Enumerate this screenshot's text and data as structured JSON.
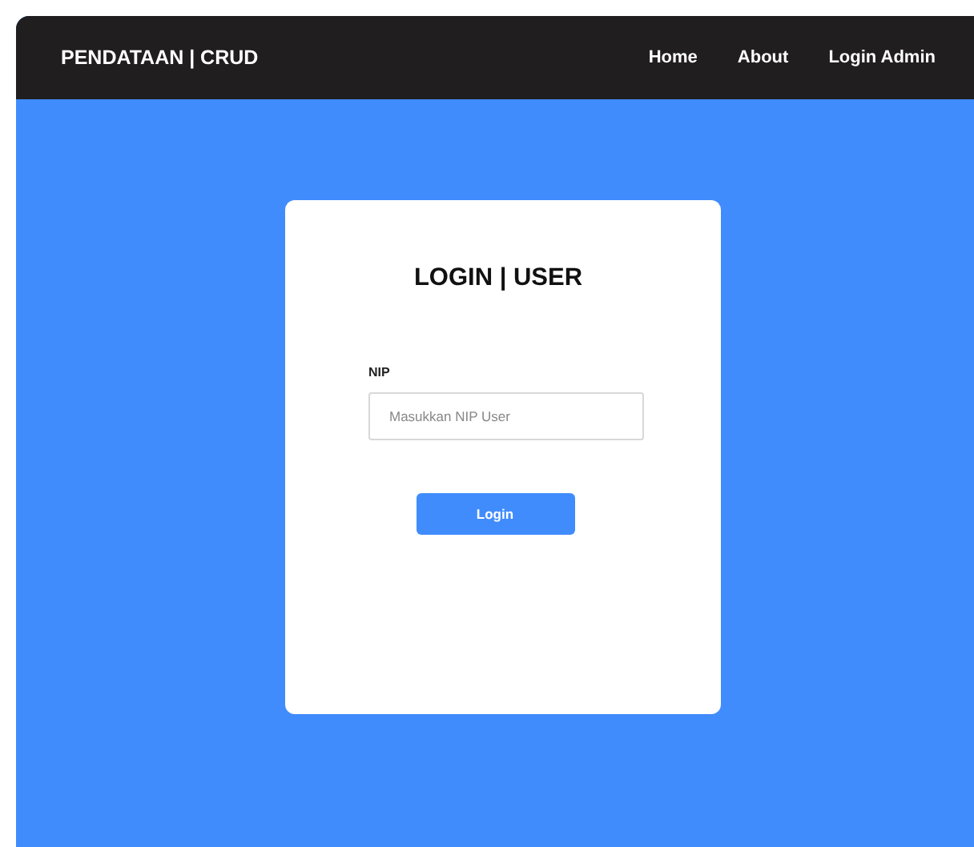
{
  "navbar": {
    "brand": "PENDATAAN | CRUD",
    "links": [
      {
        "label": "Home"
      },
      {
        "label": "About"
      },
      {
        "label": "Login Admin"
      }
    ]
  },
  "login_card": {
    "title": "LOGIN | USER",
    "field": {
      "label": "NIP",
      "placeholder": "Masukkan NIP User"
    },
    "button": "Login"
  }
}
